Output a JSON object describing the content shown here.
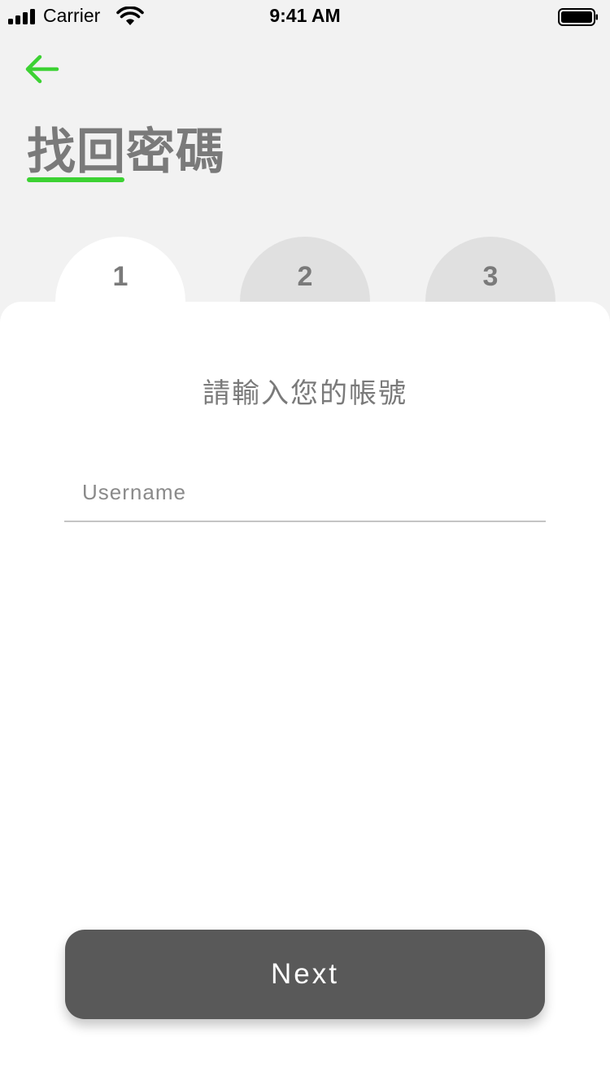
{
  "status_bar": {
    "carrier": "Carrier",
    "time": "9:41 AM"
  },
  "header": {
    "back_icon": "arrow-left-icon",
    "title": "找回密碼",
    "accent_color": "#3cd233"
  },
  "steps": [
    {
      "label": "1",
      "active": true
    },
    {
      "label": "2",
      "active": false
    },
    {
      "label": "3",
      "active": false
    }
  ],
  "form": {
    "instruction": "請輸入您的帳號",
    "username_placeholder": "Username",
    "username_value": ""
  },
  "actions": {
    "next_label": "Next"
  }
}
